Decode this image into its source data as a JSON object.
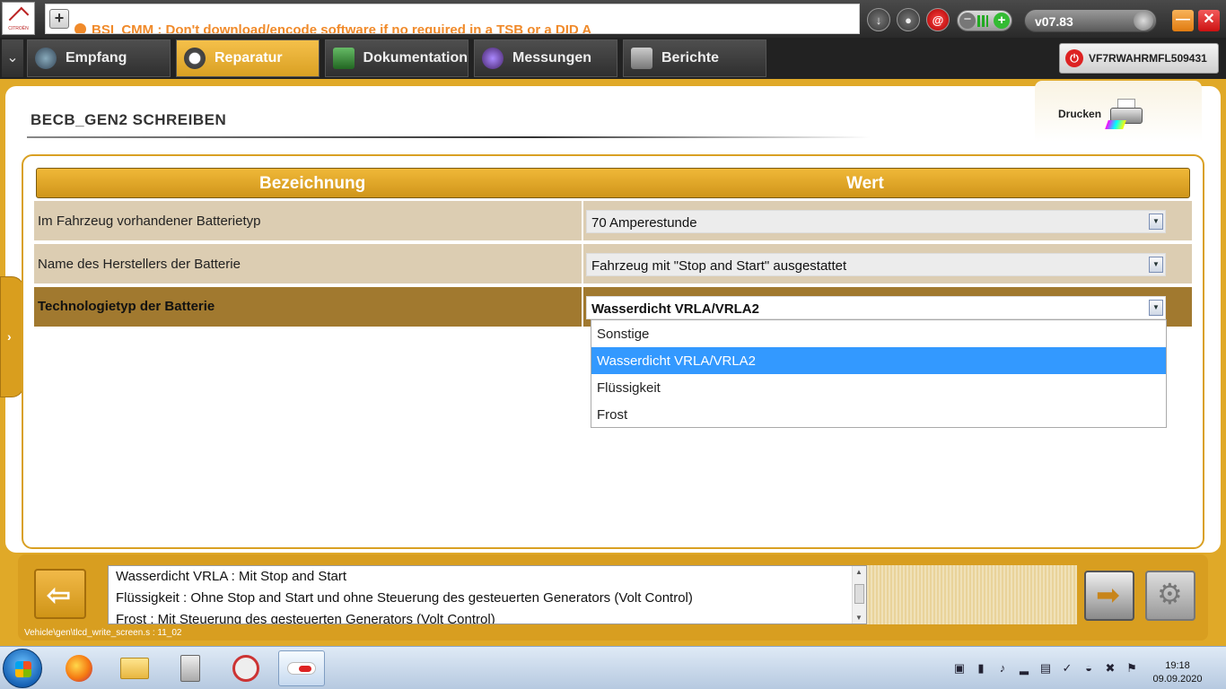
{
  "app": {
    "logo_text": "CITROËN",
    "message": "BSI_CMM : Don't download/encode software if no required in a TSB or a DID A",
    "version": "v07.83",
    "vin": "VF7RWAHRMFL509431"
  },
  "tabs": [
    {
      "label": "Empfang",
      "icon": "home-icon",
      "active": false
    },
    {
      "label": "Reparatur",
      "icon": "magnifier-icon",
      "active": true
    },
    {
      "label": "Dokumentation",
      "icon": "book-icon",
      "active": false
    },
    {
      "label": "Messungen",
      "icon": "waveform-icon",
      "active": false
    },
    {
      "label": "Berichte",
      "icon": "report-icon",
      "active": false
    }
  ],
  "page": {
    "title": "BECB_GEN2  SCHREIBEN",
    "print_label": "Drucken"
  },
  "table": {
    "headers": [
      "Bezeichnung",
      "Wert"
    ],
    "rows": [
      {
        "label": "Im Fahrzeug vorhandener Batterietyp",
        "value": "70 Amperestunde"
      },
      {
        "label": "Name des Herstellers der Batterie",
        "value": "Fahrzeug mit \"Stop and Start\" ausgestattet"
      },
      {
        "label": "Technologietyp der Batterie",
        "value": "Wasserdicht VRLA/VRLA2"
      }
    ],
    "selected_row": 2
  },
  "dropdown": {
    "options": [
      "Sonstige",
      "Wasserdicht VRLA/VRLA2",
      "Flüssigkeit",
      "Frost"
    ],
    "highlighted_index": 1
  },
  "info": {
    "lines": [
      "Wasserdicht VRLA : Mit Stop and Start",
      "Flüssigkeit : Ohne Stop and Start und ohne Steuerung des gesteuerten Generators (Volt Control)",
      "Frost : Mit Steuerung des gesteuerten Generators (Volt Control)"
    ]
  },
  "status_path": "Vehicle\\gen\\tlcd_write_screen.s : 11_02",
  "taskbar": {
    "apps": [
      "firefox-icon",
      "folder-icon",
      "calculator-icon",
      "tool-icon",
      "diagbox-icon"
    ],
    "time": "19:18",
    "date": "09.09.2020"
  },
  "colors": {
    "accent_gold": "#e0a928",
    "selected_row": "#a1792f",
    "highlight_blue": "#3399ff",
    "message_orange": "#f08a2a"
  }
}
